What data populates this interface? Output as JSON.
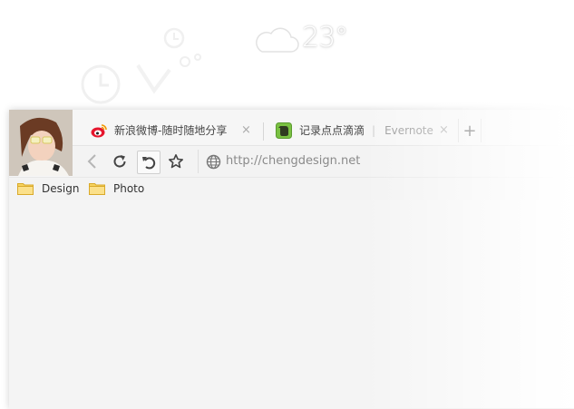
{
  "weather": {
    "temperature": "23°",
    "icon": "cloud-icon"
  },
  "widgets": {
    "clock_icon": "clock-icon",
    "timer_icon": "stopwatch-icon"
  },
  "tabs": [
    {
      "title": "新浪微博-随时随地分享",
      "icon": "weibo-icon",
      "close": "×"
    },
    {
      "title": "记录点点滴滴",
      "icon": "evernote-icon",
      "separator": "|",
      "extra": "Evernote",
      "close": "×"
    }
  ],
  "new_tab": {
    "label": "+"
  },
  "toolbar": {
    "back_icon": "back-icon",
    "reload_icon": "reload-icon",
    "undo_icon": "undo-icon",
    "bookmark_icon": "star-icon",
    "globe_icon": "globe-icon",
    "url": "http://chengdesign.net"
  },
  "bookmarks": [
    {
      "label": "Design",
      "icon": "folder-icon"
    },
    {
      "label": "Photo",
      "icon": "folder-icon"
    }
  ],
  "colors": {
    "folder": "#f7d35f",
    "weibo_red": "#e6162d",
    "evernote_green": "#7ac142"
  }
}
